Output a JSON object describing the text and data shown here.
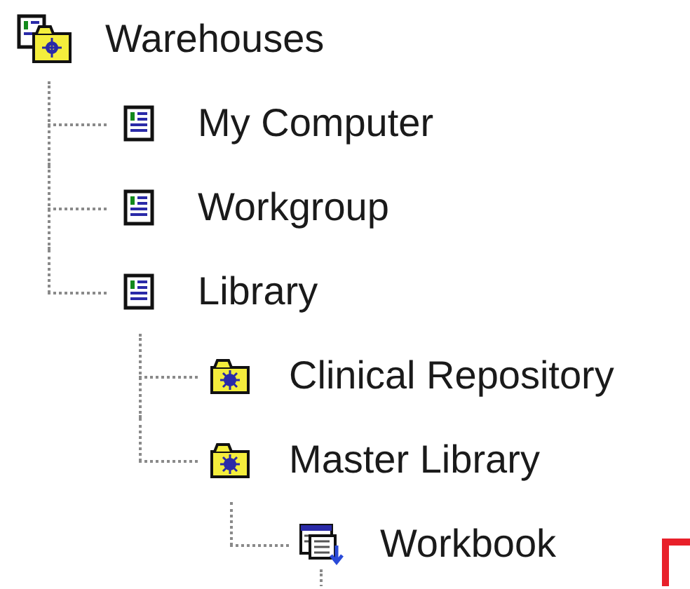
{
  "tree": {
    "label": "Warehouses",
    "kind": "warehouses",
    "children": [
      {
        "label": "My Computer",
        "kind": "computer"
      },
      {
        "label": "Workgroup",
        "kind": "computer"
      },
      {
        "label": "Library",
        "kind": "computer",
        "children": [
          {
            "label": "Clinical Repository",
            "kind": "folder"
          },
          {
            "label": "Master Library",
            "kind": "folder",
            "children": [
              {
                "label": "Workbook",
                "kind": "workbook",
                "more_below": true
              }
            ]
          }
        ]
      }
    ]
  }
}
